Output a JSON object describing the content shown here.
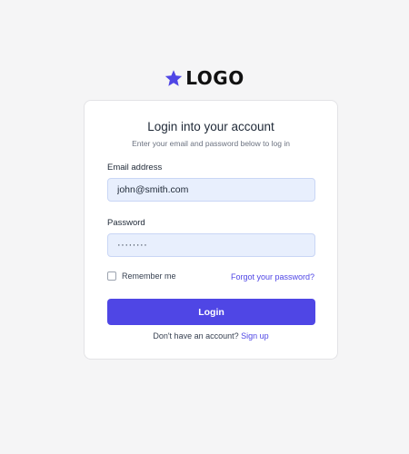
{
  "logo": {
    "icon": "star-icon",
    "text": "LOGO",
    "color": "#4f46e5"
  },
  "card": {
    "title": "Login into your account",
    "subtitle": "Enter your email and password below to log in",
    "email": {
      "label": "Email address",
      "value": "john@smith.com"
    },
    "password": {
      "label": "Password",
      "value": "········"
    },
    "remember_label": "Remember me",
    "forgot_label": "Forgot your password?",
    "login_label": "Login",
    "signup_prompt": "Don't have an account?",
    "signup_link": "Sign up"
  },
  "colors": {
    "accent": "#4f46e5",
    "input_bg": "#e8effd",
    "page_bg": "#f5f5f6"
  }
}
